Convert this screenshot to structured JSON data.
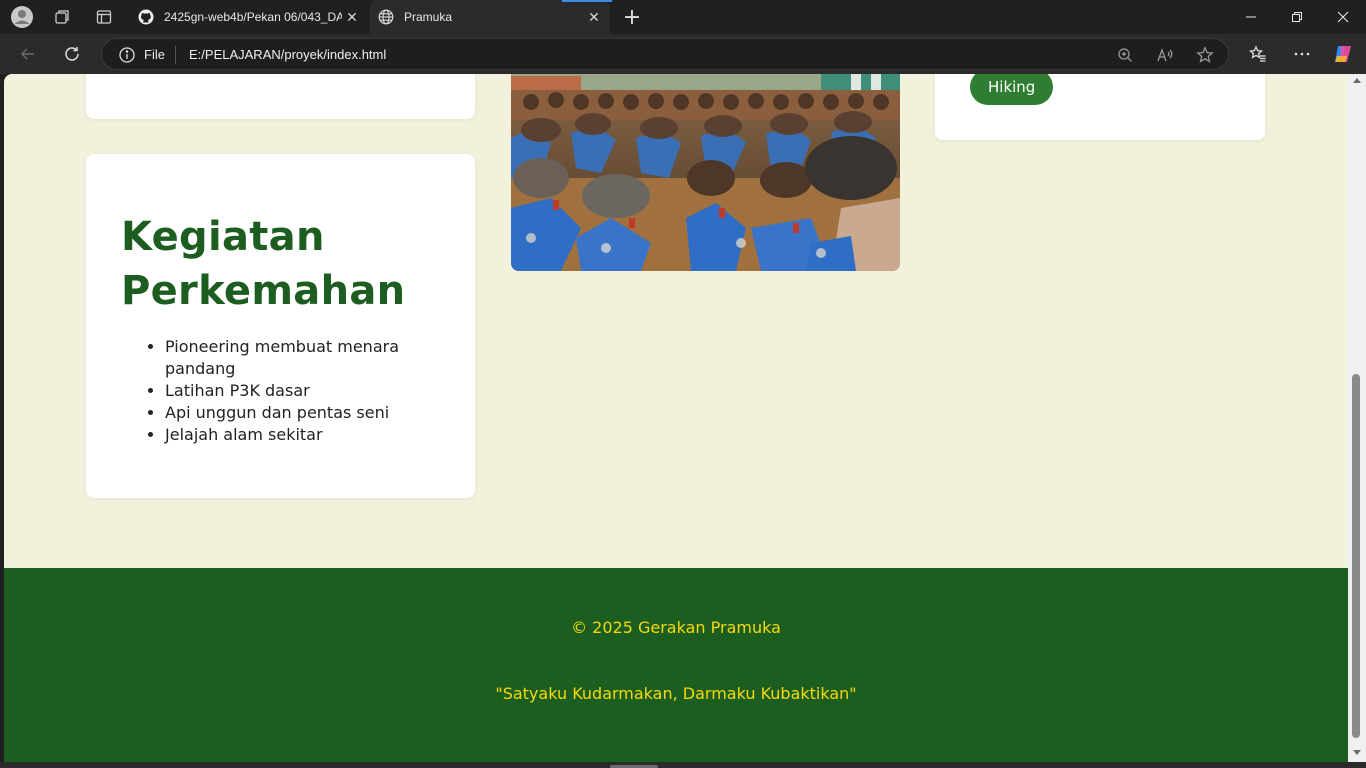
{
  "browser": {
    "tabs": [
      {
        "title": "2425gn-web4b/Pekan 06/043_DA",
        "icon": "github-icon",
        "active": false
      },
      {
        "title": "Pramuka",
        "icon": "globe-icon",
        "active": true
      }
    ],
    "new_tab_label": "+",
    "address": {
      "scheme_label": "File",
      "url": "E:/PELAJARAN/proyek/index.html"
    }
  },
  "page": {
    "camp_card": {
      "title_line1": "Kegiatan",
      "title_line2": "Perkemahan",
      "items": [
        "Pioneering membuat menara pandang",
        "Latihan P3K dasar",
        "Api unggun dan pentas seni",
        "Jelajah alam sekitar"
      ]
    },
    "photo": {
      "icon": "scouts-photo"
    },
    "right_card": {
      "pill_label": "Hiking"
    },
    "footer": {
      "copyright": "© 2025 Gerakan Pramuka",
      "motto": "\"Satyaku Kudarmakan, Darmaku Kubaktikan\""
    }
  },
  "colors": {
    "page_bg": "#f2f2dc",
    "heading_green": "#1d5e20",
    "pill_green": "#2e7d32",
    "footer_green": "#1c5e20",
    "footer_text": "#f5d90a"
  }
}
